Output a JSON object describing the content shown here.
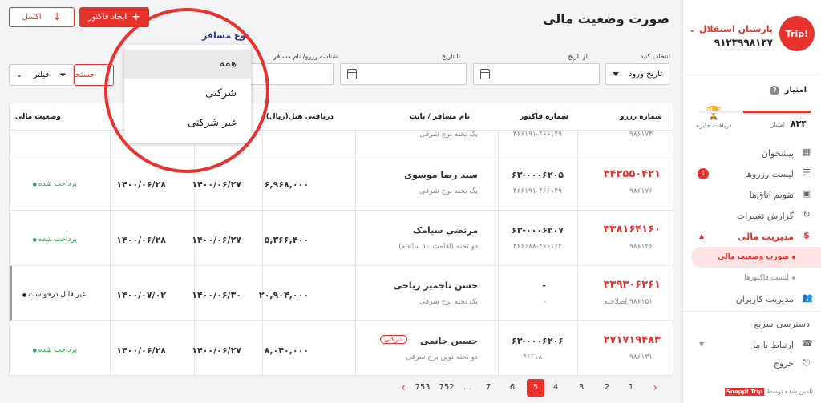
{
  "sidebar": {
    "logo": "Trip!",
    "agency_name": "پارسیان استقلال",
    "phone": "۹۱۲۳۹۹۸۱۳۷",
    "score_title": "امتیاز",
    "score_label": "امتیاز",
    "score_value": "۸۳۴",
    "score_progress": 0.6,
    "prize_label": "دریافت جایزه",
    "menu": {
      "dashboard": "پیشخوان",
      "bookings": "لیست رزروها",
      "bookings_badge": "1",
      "room_calendar": "تقویم اتاق‌ها",
      "changes_report": "گزارش تغییرات",
      "finance": "مدیریت مالی",
      "statement": "صورت وضعیت مالی",
      "invoices": "لیست فاکتورها",
      "users": "مدیریت کاربران",
      "quick_access": "دسترسی سریع",
      "contact": "ارتباط با ما",
      "logout": "خروج"
    },
    "footer_text": "تامین شده توسط",
    "footer_brand": "Snapp! Trip"
  },
  "header": {
    "title": "صورت وضعیت مالی",
    "create_invoice": "ایجاد فاکتور",
    "excel": "اکسل"
  },
  "filters": {
    "select_label": "انتخاب کنید",
    "select_value": "تاریخ ورود",
    "from_label": "از تاریخ",
    "to_label": "تا تاریخ",
    "booking_id_label": "شناسه رزرو/ نام مسافر",
    "search_btn": "جستجو",
    "filter_btn": "فیلتر"
  },
  "passenger_type": {
    "title": "نوع مسافر",
    "options": [
      "همه",
      "شرکتی",
      "غیر شرکتی"
    ],
    "selected": "همه"
  },
  "table": {
    "headers": {
      "booking_no": "شماره رزرو",
      "invoice_no": "شماره فاکتور",
      "passenger": "نام مسافر / بابت",
      "hotel_received": "دریافتی هتل(ریال)",
      "status": "وضعیت مالی"
    },
    "rows": [
      {
        "booking_sub": "۹۸۶۱۷۴",
        "invoice_sub": "۴۶۶۱۹۱-۴۶۶۱۴۹",
        "passenger_sub": "یک تخته برج شرقی"
      },
      {
        "booking_no": "۳۴۲۵۵۰۴۲۱",
        "booking_sub": "۹۸۶۱۷۶",
        "invoice_no": "۶۳-۰۰۰۶۲۰۵",
        "invoice_sub": "۴۶۶۱۹۱-۴۶۶۱۴۹",
        "passenger": "سید رضا موسوی",
        "passenger_sub": "یک تخته برج شرقی",
        "amount": "۶,۹۶۸,۰۰۰",
        "date1": "۱۴۰۰/۰۶/۲۷",
        "date2": "۱۴۰۰/۰۶/۲۸",
        "status": "پرداخت شده"
      },
      {
        "booking_no": "۳۳۸۱۶۴۱۶۰",
        "booking_sub": "۹۸۶۱۴۶",
        "invoice_no": "۶۳-۰۰۰۶۲۰۷",
        "invoice_sub": "۴۶۶۱۸۸-۴۶۶۱۶۲",
        "passenger": "مرتضی سیامک",
        "passenger_sub": "دو تخته (اقامت ۱۰ ساعته)",
        "amount": "۵,۳۶۶,۴۰۰",
        "date1": "۱۴۰۰/۰۶/۲۷",
        "date2": "۱۴۰۰/۰۶/۲۸",
        "status": "پرداخت شده"
      },
      {
        "booking_no": "۳۳۹۳۰۶۳۶۱",
        "booking_sub": "۹۸۶۱۵۱ اصلاحیه",
        "invoice_no": "-",
        "invoice_sub": "-",
        "passenger": "حسن تاجمیر ریاحی",
        "passenger_sub": "یک تخته برج شرقی",
        "amount": "۲۰,۹۰۴,۰۰۰",
        "date1": "۱۴۰۰/۰۶/۳۰",
        "date2": "۱۴۰۰/۰۷/۰۲",
        "status": "غیر قابل درخواست"
      },
      {
        "booking_no": "۲۷۱۷۱۹۴۸۳",
        "booking_sub": "۹۸۶۱۳۱",
        "invoice_no": "۶۳-۰۰۰۶۲۰۶",
        "invoice_sub": "۴۶۶۱۸۰",
        "passenger": "حسین حاتمی",
        "passenger_sub": "دو تخته توین برج شرقی",
        "tag": "شرکتی",
        "amount": "۸,۰۴۰,۰۰۰",
        "date1": "۱۴۰۰/۰۶/۲۷",
        "date2": "۱۴۰۰/۰۶/۲۸",
        "status": "پرداخت شده"
      }
    ]
  },
  "pagination": {
    "pages": [
      "1",
      "2",
      "3",
      "4",
      "5",
      "6",
      "7",
      "...",
      "752",
      "753"
    ],
    "active": "5"
  },
  "colors": {
    "accent": "#e8322e",
    "paid": "#27a94e",
    "dropdown_title": "#2a3a8c"
  }
}
